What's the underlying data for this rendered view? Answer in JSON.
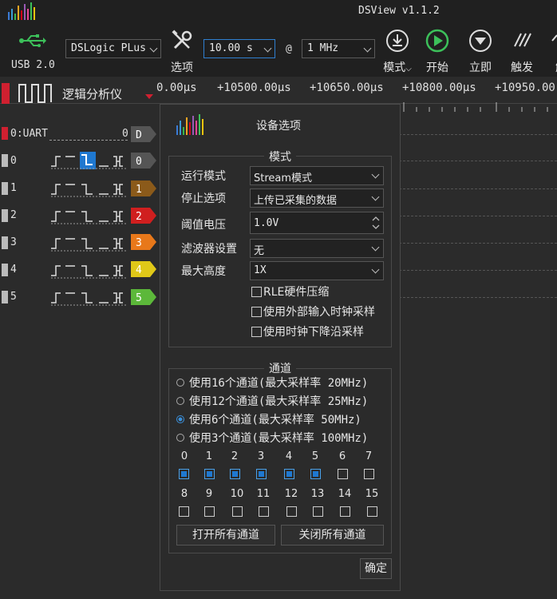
{
  "window": {
    "title": "DSView v1.1.2"
  },
  "toolbar": {
    "usb_label": "USB 2.0",
    "device": "DSLogic PLus",
    "options_label": "选项",
    "duration": "10.00 s",
    "at": "@",
    "rate": "1 MHz",
    "mode_label": "模式",
    "start_label": "开始",
    "instant_label": "立即",
    "trigger_label": "触发",
    "decode_label": "解"
  },
  "ruler": {
    "analyzer_label": "逻辑分析仪",
    "ticks": [
      "0.00μs",
      "+10500.00μs",
      "+10650.00μs",
      "+10800.00μs",
      "+10950.00"
    ]
  },
  "channels": [
    {
      "label": "0:UART",
      "value": "0",
      "tag": "D",
      "color": "#555555"
    },
    {
      "label": "0",
      "tag": "0",
      "color": "#555555"
    },
    {
      "label": "1",
      "tag": "1",
      "color": "#8b5a1a"
    },
    {
      "label": "2",
      "tag": "2",
      "color": "#d01f1f"
    },
    {
      "label": "3",
      "tag": "3",
      "color": "#e8781a"
    },
    {
      "label": "4",
      "tag": "4",
      "color": "#e0c818"
    },
    {
      "label": "5",
      "tag": "5",
      "color": "#5cb83a"
    }
  ],
  "dialog": {
    "title": "设备选项",
    "mode_group": "模式",
    "fields": [
      {
        "label": "运行模式",
        "value": "Stream模式"
      },
      {
        "label": "停止选项",
        "value": "上传已采集的数据"
      },
      {
        "label": "阈值电压",
        "value": "1.0V"
      },
      {
        "label": "滤波器设置",
        "value": "无"
      },
      {
        "label": "最大高度",
        "value": "1X"
      }
    ],
    "checkboxes": [
      "RLE硬件压缩",
      "使用外部输入时钟采样",
      "使用时钟下降沿采样"
    ],
    "channel_group": "通道",
    "radios": [
      {
        "label": "使用16个通道(最大采样率 20MHz)",
        "selected": false
      },
      {
        "label": "使用12个通道(最大采样率 25MHz)",
        "selected": false
      },
      {
        "label": "使用6个通道(最大采样率 50MHz)",
        "selected": true
      },
      {
        "label": "使用3个通道(最大采样率 100MHz)",
        "selected": false
      }
    ],
    "channel_numbers": [
      "0",
      "1",
      "2",
      "3",
      "4",
      "5",
      "6",
      "7",
      "8",
      "9",
      "10",
      "11",
      "12",
      "13",
      "14",
      "15"
    ],
    "channel_enabled": [
      true,
      true,
      true,
      true,
      true,
      true,
      false,
      false,
      false,
      false,
      false,
      false,
      false,
      false,
      false,
      false
    ],
    "enable_all": "打开所有通道",
    "disable_all": "关闭所有通道",
    "ok": "确定"
  },
  "colors": {
    "accent": "#2f7fd0",
    "start_green": "#3cc05a"
  }
}
